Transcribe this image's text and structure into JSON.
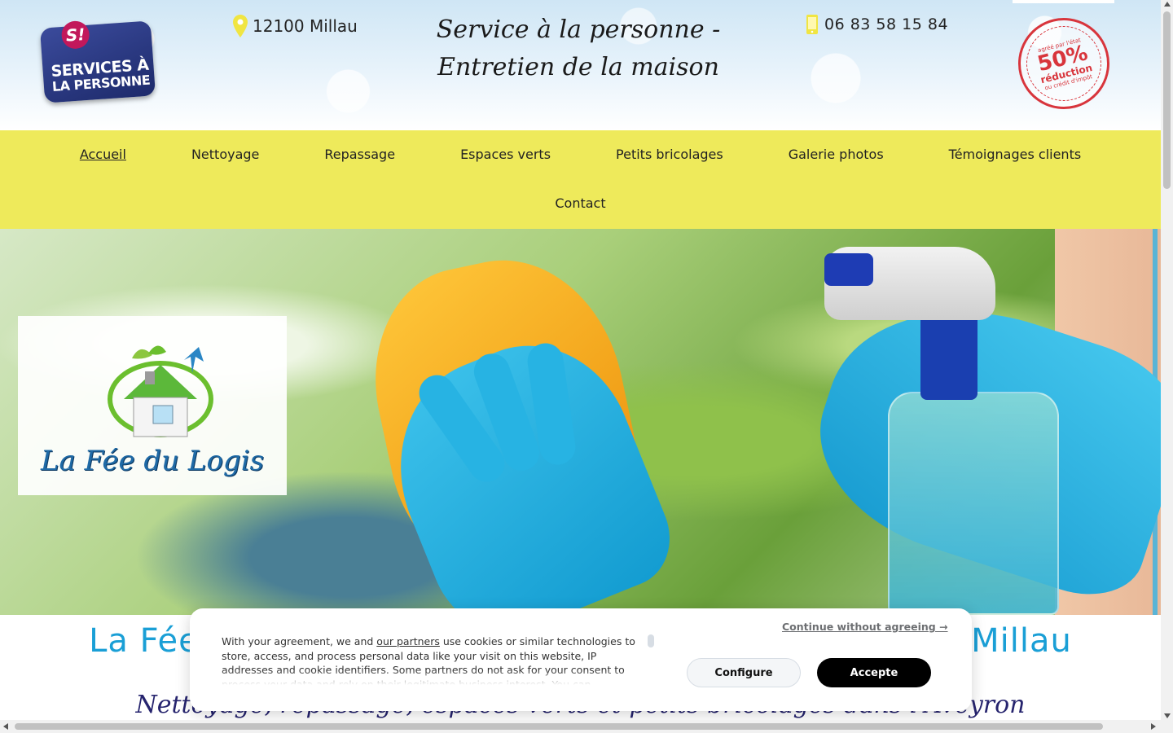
{
  "header": {
    "sap_logo": {
      "badge": "S!",
      "line1": "SERVICES À",
      "line2": "LA PERSONNE"
    },
    "location": "12100 Millau",
    "tagline": "Service à la personne - Entretien de la maison",
    "phone": "06 83 58 15 84",
    "stamp": {
      "percent": "50%",
      "label": "réduction",
      "sub": "ou crédit d'impôt",
      "ring": "agréé par l'état"
    }
  },
  "nav": {
    "items": [
      {
        "label": "Accueil"
      },
      {
        "label": "Nettoyage"
      },
      {
        "label": "Repassage"
      },
      {
        "label": "Espaces verts"
      },
      {
        "label": "Petits bricolages"
      },
      {
        "label": "Galerie photos"
      },
      {
        "label": "Témoignages clients"
      }
    ],
    "contact": "Contact"
  },
  "hero": {
    "logo_text": "La Fée du Logis"
  },
  "content": {
    "h1_left": "La Fée",
    "h1_right": "Millau",
    "subtitle": "Nettoyage, repassage, espaces verts et petits bricolages dans l'Aveyron"
  },
  "cookie": {
    "text_before": "With your agreement, we and ",
    "partners_link": "our partners",
    "text_after": " use cookies or similar technologies to store, access, and process personal data like your visit on this website, IP addresses and cookie identifiers. Some partners do not ask for your consent to process your data and rely on their legitimate business interest. You can",
    "continue": "Continue without agreeing →",
    "configure": "Configure",
    "accept": "Accepte"
  },
  "colors": {
    "nav_bg": "#eeea5b",
    "title_blue": "#1a9fd6",
    "subtitle_navy": "#26246e",
    "stamp_red": "#d8353c"
  }
}
